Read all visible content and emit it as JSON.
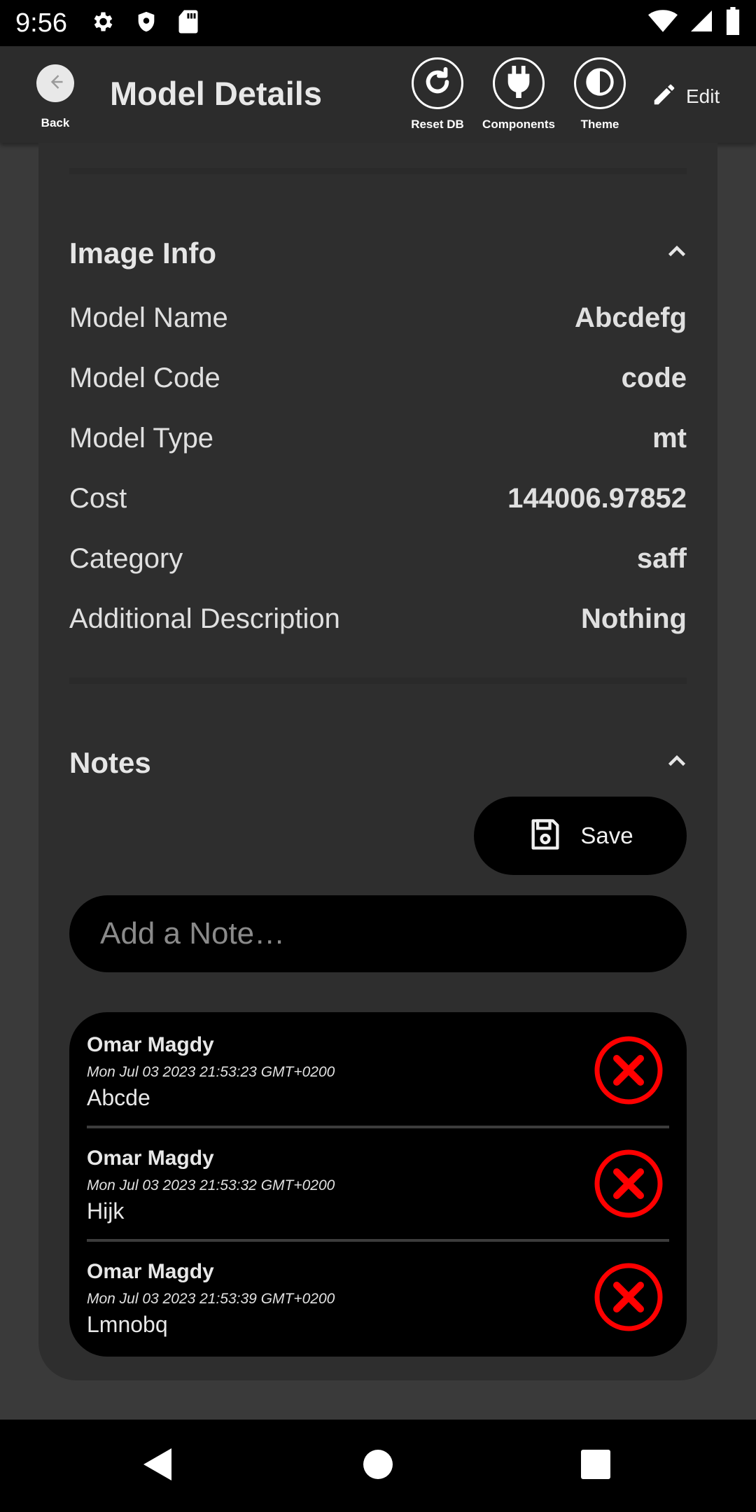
{
  "status_bar": {
    "time": "9:56",
    "left_icons": [
      "settings-icon",
      "shield-icon",
      "sd-card-icon"
    ],
    "right_icons": [
      "wifi-icon",
      "signal-icon",
      "battery-icon"
    ]
  },
  "header": {
    "back_label": "Back",
    "title": "Model Details",
    "actions": [
      {
        "label": "Reset DB",
        "icon": "refresh-icon"
      },
      {
        "label": "Components",
        "icon": "plug-icon"
      },
      {
        "label": "Theme",
        "icon": "contrast-icon"
      }
    ],
    "edit_label": "Edit"
  },
  "image_info": {
    "title": "Image Info",
    "rows": [
      {
        "label": "Model Name",
        "value": "Abcdefg"
      },
      {
        "label": "Model Code",
        "value": "code"
      },
      {
        "label": "Model Type",
        "value": "mt"
      },
      {
        "label": "Cost",
        "value": "144006.97852"
      },
      {
        "label": "Category",
        "value": "saff"
      },
      {
        "label": "Additional Description",
        "value": "Nothing"
      }
    ]
  },
  "notes": {
    "title": "Notes",
    "save_label": "Save",
    "input_placeholder": "Add a Note…",
    "items": [
      {
        "author": "Omar Magdy",
        "date": "Mon Jul 03 2023 21:53:23 GMT+0200",
        "text": "Abcde"
      },
      {
        "author": "Omar Magdy",
        "date": "Mon Jul 03 2023 21:53:32 GMT+0200",
        "text": "Hijk"
      },
      {
        "author": "Omar Magdy",
        "date": "Mon Jul 03 2023 21:53:39 GMT+0200",
        "text": "Lmnobq"
      }
    ]
  },
  "colors": {
    "background": "#3a3a3a",
    "card": "#2e2e2e",
    "header": "#2c2c2c",
    "delete": "#ff0000"
  }
}
